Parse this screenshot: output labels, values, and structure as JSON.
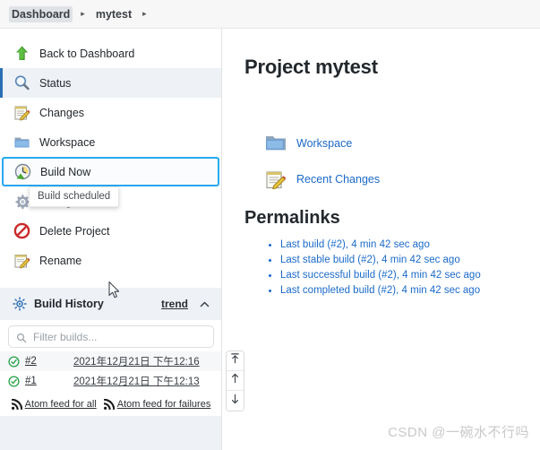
{
  "breadcrumb": {
    "items": [
      {
        "label": "Dashboard",
        "selected": true
      },
      {
        "label": "mytest",
        "selected": false
      }
    ],
    "separator": "▸"
  },
  "sidebar": {
    "tasks": [
      {
        "label": "Back to Dashboard",
        "icon": "up-arrow-icon",
        "state": "normal"
      },
      {
        "label": "Status",
        "icon": "magnifier-icon",
        "state": "active"
      },
      {
        "label": "Changes",
        "icon": "notepad-pencil-icon",
        "state": "normal"
      },
      {
        "label": "Workspace",
        "icon": "folder-icon",
        "state": "normal"
      },
      {
        "label": "Build Now",
        "icon": "build-clock-icon",
        "state": "focused"
      },
      {
        "label": "Configure",
        "icon": "gear-icon",
        "state": "normal"
      },
      {
        "label": "Delete Project",
        "icon": "delete-icon",
        "state": "normal"
      },
      {
        "label": "Rename",
        "icon": "rename-icon",
        "state": "normal"
      }
    ],
    "tooltip": {
      "text": "Build scheduled"
    },
    "build_history": {
      "title": "Build History",
      "icon": "sun-icon",
      "trend_label": "trend",
      "collapse_icon": "chevron-up-icon"
    },
    "filter": {
      "placeholder": "Filter builds...",
      "value": "",
      "icon": "search-icon"
    },
    "builds": [
      {
        "status_icon": "success-check-icon",
        "number": "#2",
        "timestamp": "2021年12月21日 下午12:16"
      },
      {
        "status_icon": "success-check-icon",
        "number": "#1",
        "timestamp": "2021年12月21日 下午12:13"
      }
    ],
    "feeds": [
      {
        "label": "Atom feed for all",
        "icon": "rss-icon"
      },
      {
        "label": "Atom feed for failures",
        "icon": "rss-icon"
      }
    ]
  },
  "scroll_buttons": [
    {
      "name": "scroll-to-top-button",
      "icon": "arrow-to-top-icon"
    },
    {
      "name": "scroll-up-button",
      "icon": "arrow-up-icon"
    },
    {
      "name": "scroll-down-button",
      "icon": "arrow-down-icon"
    }
  ],
  "main": {
    "title": "Project mytest",
    "links": [
      {
        "label": "Workspace",
        "icon": "folder-icon"
      },
      {
        "label": "Recent Changes",
        "icon": "notepad-pencil-icon"
      }
    ],
    "permalinks_heading": "Permalinks",
    "permalinks": [
      "Last build (#2), 4 min 42 sec ago",
      "Last stable build (#2), 4 min 42 sec ago",
      "Last successful build (#2), 4 min 42 sec ago",
      "Last completed build (#2), 4 min 42 sec ago"
    ]
  },
  "watermark": {
    "text": "CSDN @一碗水不行吗"
  },
  "colors": {
    "accent_blue": "#1b6ac9",
    "focus_blue": "#28a8f0",
    "active_bg": "#eef1f6",
    "success_green": "#24a148",
    "danger_red": "#cc2a2a"
  }
}
